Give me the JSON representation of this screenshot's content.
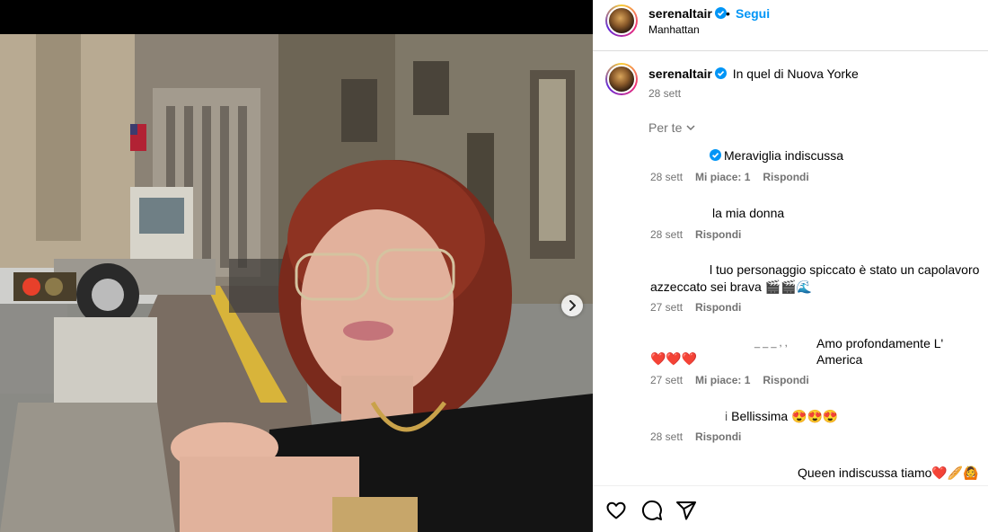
{
  "post": {
    "username": "serenaltair",
    "follow_separator": "•",
    "follow_label": "Segui",
    "location": "Manhattan"
  },
  "caption": {
    "username": "serenaltair",
    "text": "In quel di Nuova Yorke",
    "time": "28 sett"
  },
  "sort": {
    "label": "Per te"
  },
  "comments": [
    {
      "text": "Meraviglia indiscussa",
      "time": "28 sett",
      "likes": "Mi piace: 1",
      "reply": "Rispondi"
    },
    {
      "text": "la mia donna",
      "time": "28 sett",
      "reply": "Rispondi"
    },
    {
      "text_line1": "l tuo personaggio spiccato è stato un capolavoro",
      "text_line2": "azzeccato sei brava 🎬🎬🌊",
      "time": "27 sett",
      "reply": "Rispondi"
    },
    {
      "text_prefix": "_ _ _ , ,",
      "text": "Amo profondamente L' America",
      "emoji": "❤️❤️❤️",
      "time": "27 sett",
      "likes": "Mi piace: 1",
      "reply": "Rispondi"
    },
    {
      "text": "Bellissima 😍😍😍",
      "prefix": "i",
      "time": "28 sett",
      "reply": "Rispondi"
    },
    {
      "text": "Queen indiscussa tiamo❤️🥖🙆"
    }
  ],
  "icons": [
    "like-icon",
    "comment-icon",
    "share-icon",
    "next-arrow-icon",
    "verified-badge-icon",
    "chevron-down-icon"
  ],
  "colors": {
    "link": "#0095f6",
    "muted": "#737373",
    "verified": "#0095f6",
    "divider": "#dbdbdb"
  }
}
